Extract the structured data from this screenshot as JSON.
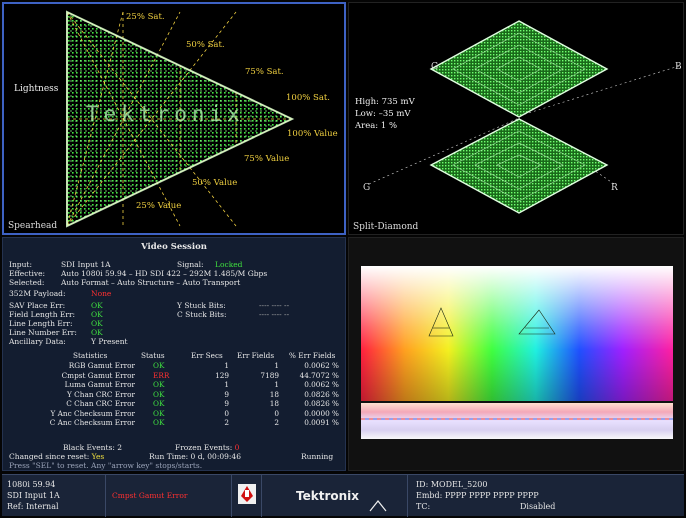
{
  "spearhead": {
    "title": "Spearhead",
    "lightness_label": "Lightness",
    "watermark": "Tektronix",
    "sat_labels": [
      "25% Sat.",
      "50% Sat.",
      "75% Sat.",
      "100% Sat."
    ],
    "value_labels": [
      "100% Value",
      "75% Value",
      "50% Value",
      "25% Value"
    ]
  },
  "split_diamond": {
    "title": "Split-Diamond",
    "top_left_label": "G",
    "top_right_label": "B",
    "bottom_left_label": "G",
    "bottom_right_label": "R",
    "high": "High: 735 mV",
    "low": "Low: –35 mV",
    "area": "Area:  1 %"
  },
  "session": {
    "title": "Video Session",
    "input_label": "Input:",
    "input_value": "SDI Input 1A",
    "signal_label": "Signal:",
    "signal_value": "Locked",
    "effective_label": "Effective:",
    "effective_value": "Auto 1080i 59.94 – HD SDI 422 – 292M 1.485/M Gbps",
    "selected_label": "Selected:",
    "selected_value": "Auto Format – Auto Structure – Auto Transport",
    "payload_label": "352M Payload:",
    "payload_value": "None",
    "sav_label": "SAV Place Err:",
    "sav_value": "OK",
    "ystuck_label": "Y Stuck Bits:",
    "ystuck_value": "---- ---- --",
    "field_len_label": "Field Length Err:",
    "field_len_value": "OK",
    "cstuck_label": "C Stuck Bits:",
    "cstuck_value": "---- ---- --",
    "line_len_label": "Line Length Err:",
    "line_len_value": "OK",
    "line_num_label": "Line Number Err:",
    "line_num_value": "OK",
    "anc_label": "Ancillary Data:",
    "anc_value": "Y Present",
    "table_headers": [
      "Statistics",
      "Status",
      "Err Secs",
      "Err Fields",
      "% Err Fields"
    ],
    "table_rows": [
      {
        "name": "RGB Gamut Error",
        "status": "OK",
        "secs": "1",
        "fields": "1",
        "pct": "0.0062 %"
      },
      {
        "name": "Cmpst Gamut Error",
        "status": "ERR",
        "secs": "129",
        "fields": "7189",
        "pct": "44.7072 %"
      },
      {
        "name": "Luma Gamut Error",
        "status": "OK",
        "secs": "1",
        "fields": "1",
        "pct": "0.0062 %"
      },
      {
        "name": "Y Chan CRC Error",
        "status": "OK",
        "secs": "9",
        "fields": "18",
        "pct": "0.0826 %"
      },
      {
        "name": "C Chan CRC Error",
        "status": "OK",
        "secs": "9",
        "fields": "18",
        "pct": "0.0826 %"
      },
      {
        "name": "Y Anc Checksum Error",
        "status": "OK",
        "secs": "0",
        "fields": "0",
        "pct": "0.0000 %"
      },
      {
        "name": "C Anc Checksum Error",
        "status": "OK",
        "secs": "2",
        "fields": "2",
        "pct": "0.0091 %"
      }
    ],
    "black_events": "Black Events:  2",
    "frozen_events_label": "Frozen Events:",
    "frozen_events_value": "0",
    "changed_label": "Changed since reset:",
    "changed_value": "Yes",
    "run_time": "Run Time: 0 d, 00:09:46",
    "run_state": "Running",
    "hint": "Press \"SEL\" to reset.  Any \"arrow key\" stops/starts."
  },
  "status_bar": {
    "format": "1080i 59.94",
    "input": "SDI Input 1A",
    "ref": "Ref: Internal",
    "alarm": "Cmpst Gamut Error",
    "brand": "Tektronix",
    "id": "ID: MODEL_5200",
    "embd": "Embd: PPPP PPPP PPPP PPPP",
    "tc_label": "TC:",
    "tc_value": "Disabled"
  },
  "colors": {
    "trace_green": "#3cff3c",
    "graticule_yellow": "#f0d040",
    "pane_highlight": "#3e62c4",
    "ok_green": "#3fe03f",
    "error_red": "#ff3030"
  }
}
